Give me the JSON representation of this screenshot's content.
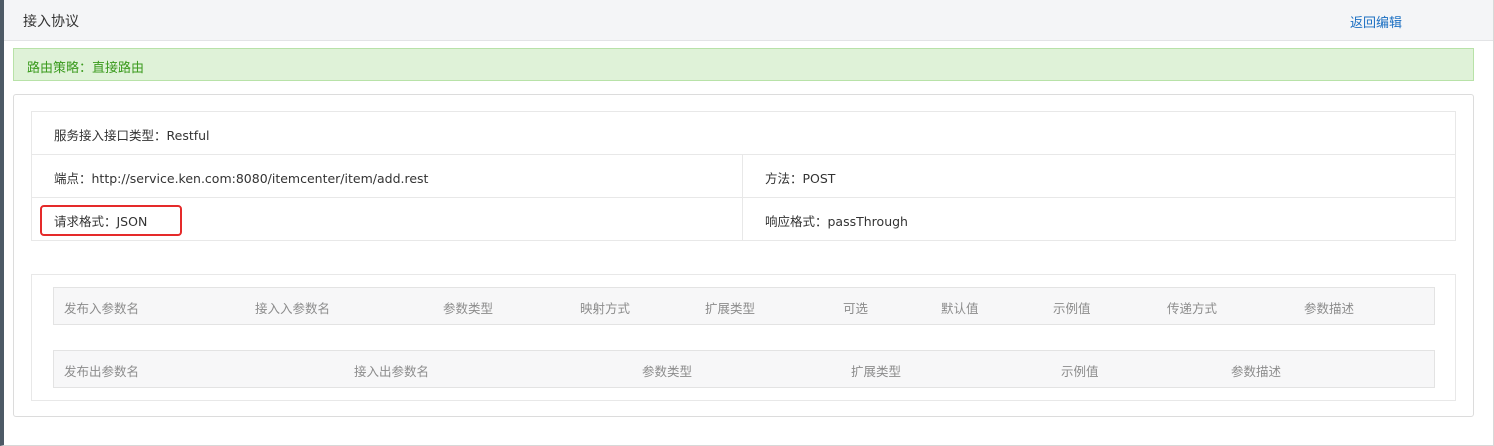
{
  "header": {
    "title": "接入协议",
    "back_link": "返回编辑"
  },
  "alert": {
    "text": "路由策略：直接路由"
  },
  "info": {
    "interface_type": "服务接入接口类型：Restful",
    "endpoint": "端点：http://service.ken.com:8080/itemcenter/item/add.rest",
    "method": "方法：POST",
    "request_format": "请求格式：JSON",
    "response_format": "响应格式：passThrough"
  },
  "input_params": {
    "headers": [
      "发布入参数名",
      "接入入参数名",
      "参数类型",
      "映射方式",
      "扩展类型",
      "可选",
      "默认值",
      "示例值",
      "传递方式",
      "参数描述"
    ]
  },
  "output_params": {
    "headers": [
      "发布出参数名",
      "接入出参数名",
      "参数类型",
      "扩展类型",
      "示例值",
      "参数描述"
    ]
  },
  "colors": {
    "link": "#1b6fc2",
    "alert_bg": "#dff2d8",
    "alert_text": "#3a9a1d",
    "highlight_border": "#e52a2a"
  }
}
